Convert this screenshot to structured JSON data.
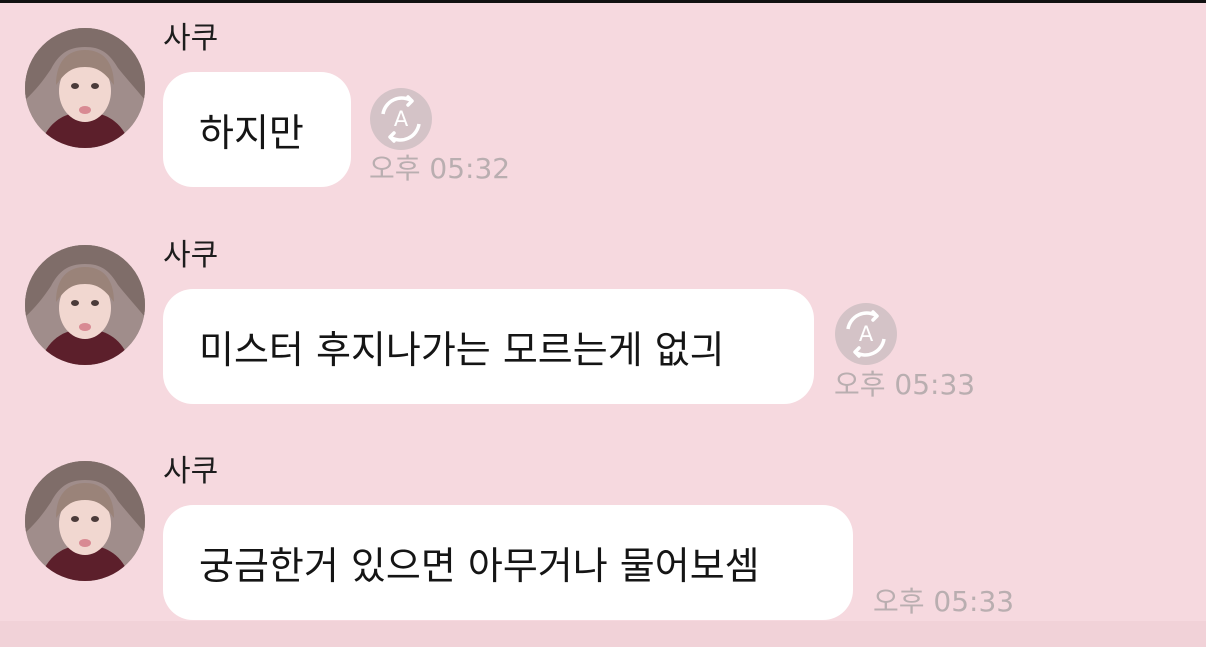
{
  "messages": [
    {
      "sender": "사쿠",
      "text": "하지만",
      "time": "오후 05:32",
      "status_icon": "translate-a-icon"
    },
    {
      "sender": "사쿠",
      "text": "미스터 후지나가는 모르는게 없긔",
      "time": "오후 05:33",
      "status_icon": "translate-a-icon"
    },
    {
      "sender": "사쿠",
      "text": "궁금한거 있으면 아무거나 물어보셈",
      "time": "오후 05:33"
    }
  ],
  "colors": {
    "background": "#f6d9df",
    "bubble": "#ffffff",
    "timestamp": "#b9aeb0",
    "status_icon": "#d4c3c7"
  }
}
